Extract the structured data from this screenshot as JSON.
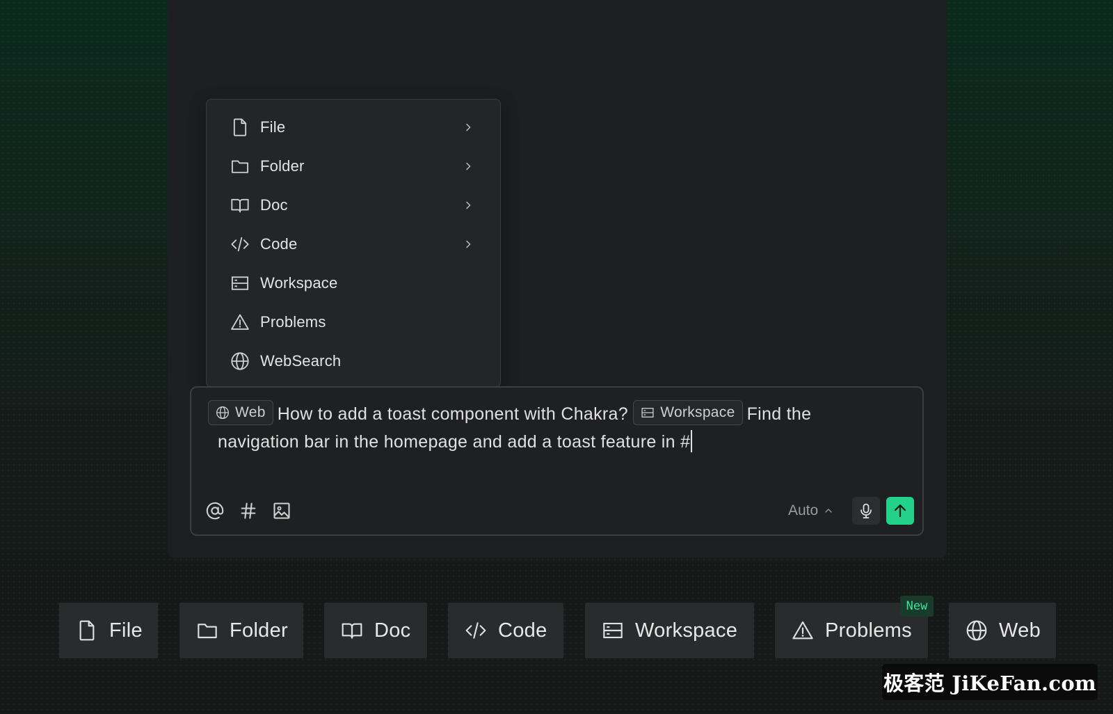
{
  "menu": {
    "items": [
      {
        "label": "File",
        "icon": "file-icon",
        "has_submenu": true
      },
      {
        "label": "Folder",
        "icon": "folder-icon",
        "has_submenu": true
      },
      {
        "label": "Doc",
        "icon": "book-icon",
        "has_submenu": true
      },
      {
        "label": "Code",
        "icon": "code-icon",
        "has_submenu": true
      },
      {
        "label": "Workspace",
        "icon": "workspace-icon",
        "has_submenu": false
      },
      {
        "label": "Problems",
        "icon": "warning-icon",
        "has_submenu": false
      },
      {
        "label": "WebSearch",
        "icon": "globe-icon",
        "has_submenu": false
      }
    ]
  },
  "composer": {
    "chip_web": "Web",
    "text_1": "How to add a toast component with Chakra?",
    "chip_workspace": "Workspace",
    "text_2": "Find the",
    "text_3": "navigation bar in the homepage and add a toast feature in #",
    "model": "Auto",
    "tools": [
      "at-icon",
      "hash-icon",
      "image-icon"
    ]
  },
  "tiles": [
    {
      "label": "File",
      "icon": "file-icon"
    },
    {
      "label": "Folder",
      "icon": "folder-icon"
    },
    {
      "label": "Doc",
      "icon": "book-icon"
    },
    {
      "label": "Code",
      "icon": "code-icon"
    },
    {
      "label": "Workspace",
      "icon": "workspace-icon"
    },
    {
      "label": "Problems",
      "icon": "warning-icon"
    },
    {
      "label": "Web",
      "icon": "globe-icon"
    }
  ],
  "badge": "New",
  "watermark": "极客范 JiKeFan.com",
  "colors": {
    "accent": "#23d18b",
    "panel": "#1d1e20",
    "menu_bg": "#242527",
    "badge_text": "#3ee39a"
  }
}
